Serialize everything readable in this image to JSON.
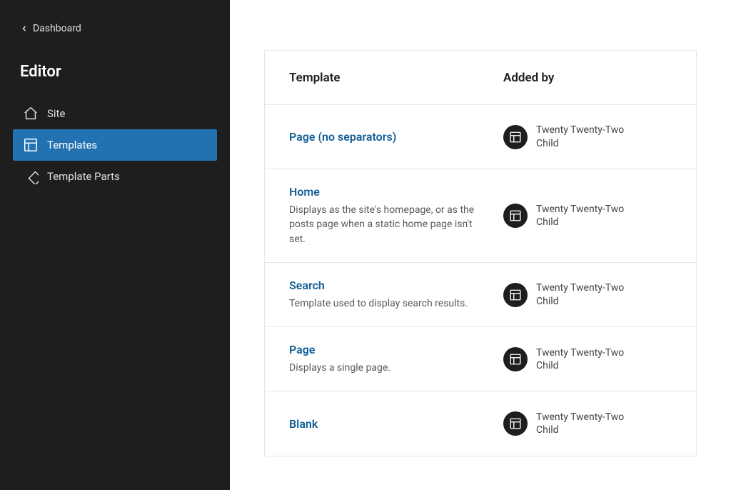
{
  "back_label": "Dashboard",
  "page_title": "Editor",
  "nav": [
    {
      "label": "Site"
    },
    {
      "label": "Templates"
    },
    {
      "label": "Template Parts"
    }
  ],
  "table": {
    "header_template": "Template",
    "header_addedby": "Added by",
    "rows": [
      {
        "name": "Page (no separators)",
        "desc": "",
        "theme": "Twenty Twenty-Two Child"
      },
      {
        "name": "Home",
        "desc": "Displays as the site's homepage, or as the posts page when a static home page isn't set.",
        "theme": "Twenty Twenty-Two Child"
      },
      {
        "name": "Search",
        "desc": "Template used to display search results.",
        "theme": "Twenty Twenty-Two Child"
      },
      {
        "name": "Page",
        "desc": "Displays a single page.",
        "theme": "Twenty Twenty-Two Child"
      },
      {
        "name": "Blank",
        "desc": "",
        "theme": "Twenty Twenty-Two Child"
      }
    ]
  }
}
